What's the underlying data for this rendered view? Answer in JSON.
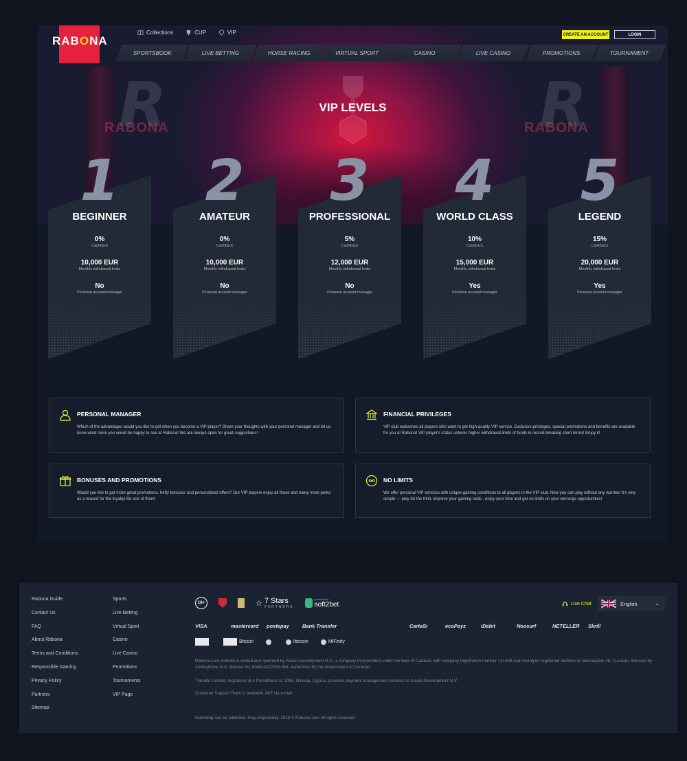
{
  "header": {
    "logo_text_a": "RAB",
    "logo_text_o": "O",
    "logo_text_b": "NA",
    "top_links": [
      "Collections",
      "CUP",
      "VIP"
    ],
    "create_account_label": "CREATE AN ACCOUNT",
    "login_label": "LOGIN",
    "nav": [
      "SPORTSBOOK",
      "LIVE BETTING",
      "HORSE RACING",
      "VIRTUAL SPORT",
      "CASINO",
      "LIVE CASINO",
      "PROMOTIONS",
      "TOURNAMENT"
    ]
  },
  "hero": {
    "title": "VIP LEVELS",
    "ghost_word": "RABONA",
    "ghost_letter": "R"
  },
  "levels": [
    {
      "num": "1",
      "name": "BEGINNER",
      "cashback": "0%",
      "cashback_label": "Cashback",
      "limit": "10,000 EUR",
      "limit_label": "Monthly withdrawal limits",
      "manager": "No",
      "manager_label": "Personal account manager"
    },
    {
      "num": "2",
      "name": "AMATEUR",
      "cashback": "0%",
      "cashback_label": "Cashback",
      "limit": "10,000 EUR",
      "limit_label": "Monthly withdrawal limits",
      "manager": "No",
      "manager_label": "Personal account manager"
    },
    {
      "num": "3",
      "name": "PROFESSIONAL",
      "cashback": "5%",
      "cashback_label": "Cashback",
      "limit": "12,000 EUR",
      "limit_label": "Monthly withdrawal limits",
      "manager": "No",
      "manager_label": "Personal account manager"
    },
    {
      "num": "4",
      "name": "WORLD CLASS",
      "cashback": "10%",
      "cashback_label": "Cashback",
      "limit": "15,000 EUR",
      "limit_label": "Monthly withdrawal limits",
      "manager": "Yes",
      "manager_label": "Personal account manager"
    },
    {
      "num": "5",
      "name": "LEGEND",
      "cashback": "15%",
      "cashback_label": "Cashback",
      "limit": "20,000 EUR",
      "limit_label": "Monthly withdrawal limits",
      "manager": "Yes",
      "manager_label": "Personal account manager"
    }
  ],
  "features": [
    {
      "icon": "manager-icon",
      "title": "PERSONAL MANAGER",
      "body": "Which of the advantages would you like to get when you become a VIP player? Share your thoughts with your personal manager and let us know what more you would be happy to see at Rabona! We are always open for great suggestions!"
    },
    {
      "icon": "bank-icon",
      "title": "FINANCIAL PRIVILEGES",
      "body": "VIP club welcomes all players who want to get high-quality VIP service. Exclusive privileges, special promotions and benefits are available for you at Rabona! VIP player's status unlocks higher withdrawal limits of funds in record-breaking short terms! Enjoy it!"
    },
    {
      "icon": "gift-icon",
      "title": "BONUSES AND PROMOTIONS",
      "body": "Would you like to get more great promotions, hefty bonuses and personalised offers? Our VIP players enjoy all these and many more perks as a reward for the loyalty! Be one of them!"
    },
    {
      "icon": "no-limits-icon",
      "title": "NO LIMITS",
      "body": "We offer personal VIP services with unique gaming conditions to all players in the VIP club. Now you can play without any worries! It's very simple — play for the thrill, improve your gaming skills , enjoy your time and get no limits on your winnings opportunities!"
    }
  ],
  "footer": {
    "col1": [
      "Rabona Guide",
      "Contact Us",
      "FAQ",
      "About Rabona",
      "Terms and Conditions",
      "Responsible Gaming",
      "Privacy Policy",
      "Partners",
      "Sitemap"
    ],
    "col2": [
      "Sports",
      "Live Betting",
      "Virtual Sport",
      "Casino",
      "Live Casino",
      "Promotions",
      "Tournaments",
      "VIP Page"
    ],
    "age_badge": "18+",
    "seven_stars": "7 Stars",
    "seven_stars_sub": "PARTNERS",
    "powered_by": "powered by",
    "soft2bet": "soft2bet",
    "live_chat": "Live Chat",
    "language": "English",
    "payments": [
      "VISA",
      "mastercard",
      "postepay",
      "Bank Transfer",
      "",
      "",
      "CartaSi",
      "ecoPayz",
      "iDebit",
      "Neosurf",
      "NETELLER",
      "Skrill"
    ],
    "payments2": [
      "",
      "Bitcoin",
      "",
      "litecoin",
      "MiFinity"
    ],
    "legal1": "Rabona.com website is owned and operated by Araxio Development N.V., a company incorporated under the laws of Curacao with company registration number 141409 and having its registered address at Julianaplein 36, Curacao, licensed by Antillephone N.V., license No. 8048/JAZ2016-064, authorized by the Government of Curacao.",
    "legal2": "Tranello Limited, registered at 4 Promitheos st, 1065, Nicosia, Cyprus, provides payment management services to Araxio Development N.V.",
    "legal3": "Customer Support Team is available 24/7 via e-mail",
    "legal4": "Gambling can be addictive. Play responsibly. 2019 © Rabona.com All rights reserved."
  }
}
